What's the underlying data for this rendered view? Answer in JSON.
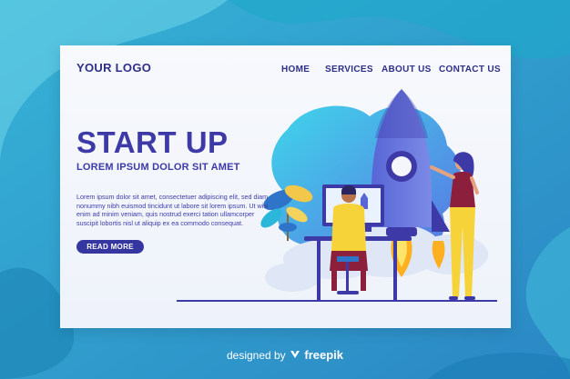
{
  "header": {
    "logo": "YOUR LOGO",
    "nav": [
      "HOME",
      "SERVICES",
      "ABOUT US",
      "CONTACT US"
    ]
  },
  "hero": {
    "title": "START UP",
    "subtitle": "LOREM IPSUM DOLOR SIT AMET",
    "body": "Lorem ipsum dolor sit amet, consectetuer adipiscing elit, sed diam nonummy nibh euismod tincidunt ut labore sit lorem ipsum. Ut wisi enim ad minim veniam, quis nostrud exerci tation ullamcorper suscipit lobortis nisl ut aliquip ex ea commodo consequat.",
    "button": "READ MORE"
  },
  "footer": {
    "prefix": "designed by",
    "brand": "freepik"
  },
  "colors": {
    "background": "#2ea0c9",
    "primary": "#3d3aa8",
    "button": "#3536a0"
  }
}
